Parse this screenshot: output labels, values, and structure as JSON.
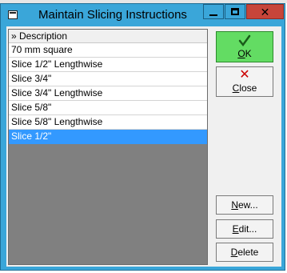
{
  "window": {
    "title": "Maintain Slicing Instructions",
    "controls": {
      "minimize": "minimize",
      "maximize": "maximize",
      "close": "close"
    }
  },
  "list": {
    "header": "» Description",
    "items": [
      "70 mm square",
      "Slice 1/2\" Lengthwise",
      "Slice 3/4\"",
      "Slice 3/4\" Lengthwise",
      "Slice 5/8\"",
      "Slice 5/8\" Lengthwise",
      "Slice 1/2\""
    ],
    "selected_index": 6
  },
  "buttons": {
    "ok": {
      "label": "OK",
      "mnemonic": "O",
      "icon": "check-icon"
    },
    "close": {
      "label": "Close",
      "mnemonic": "C",
      "icon": "x-icon"
    },
    "new": {
      "label": "New...",
      "mnemonic": "N"
    },
    "edit": {
      "label": "Edit...",
      "mnemonic": "E"
    },
    "delete": {
      "label": "Delete",
      "mnemonic": "D"
    }
  },
  "colors": {
    "titlebar": "#3aa6d9",
    "close_button": "#c7453a",
    "ok_button": "#63dc63",
    "selection": "#3399ff",
    "list_background": "#808080"
  }
}
